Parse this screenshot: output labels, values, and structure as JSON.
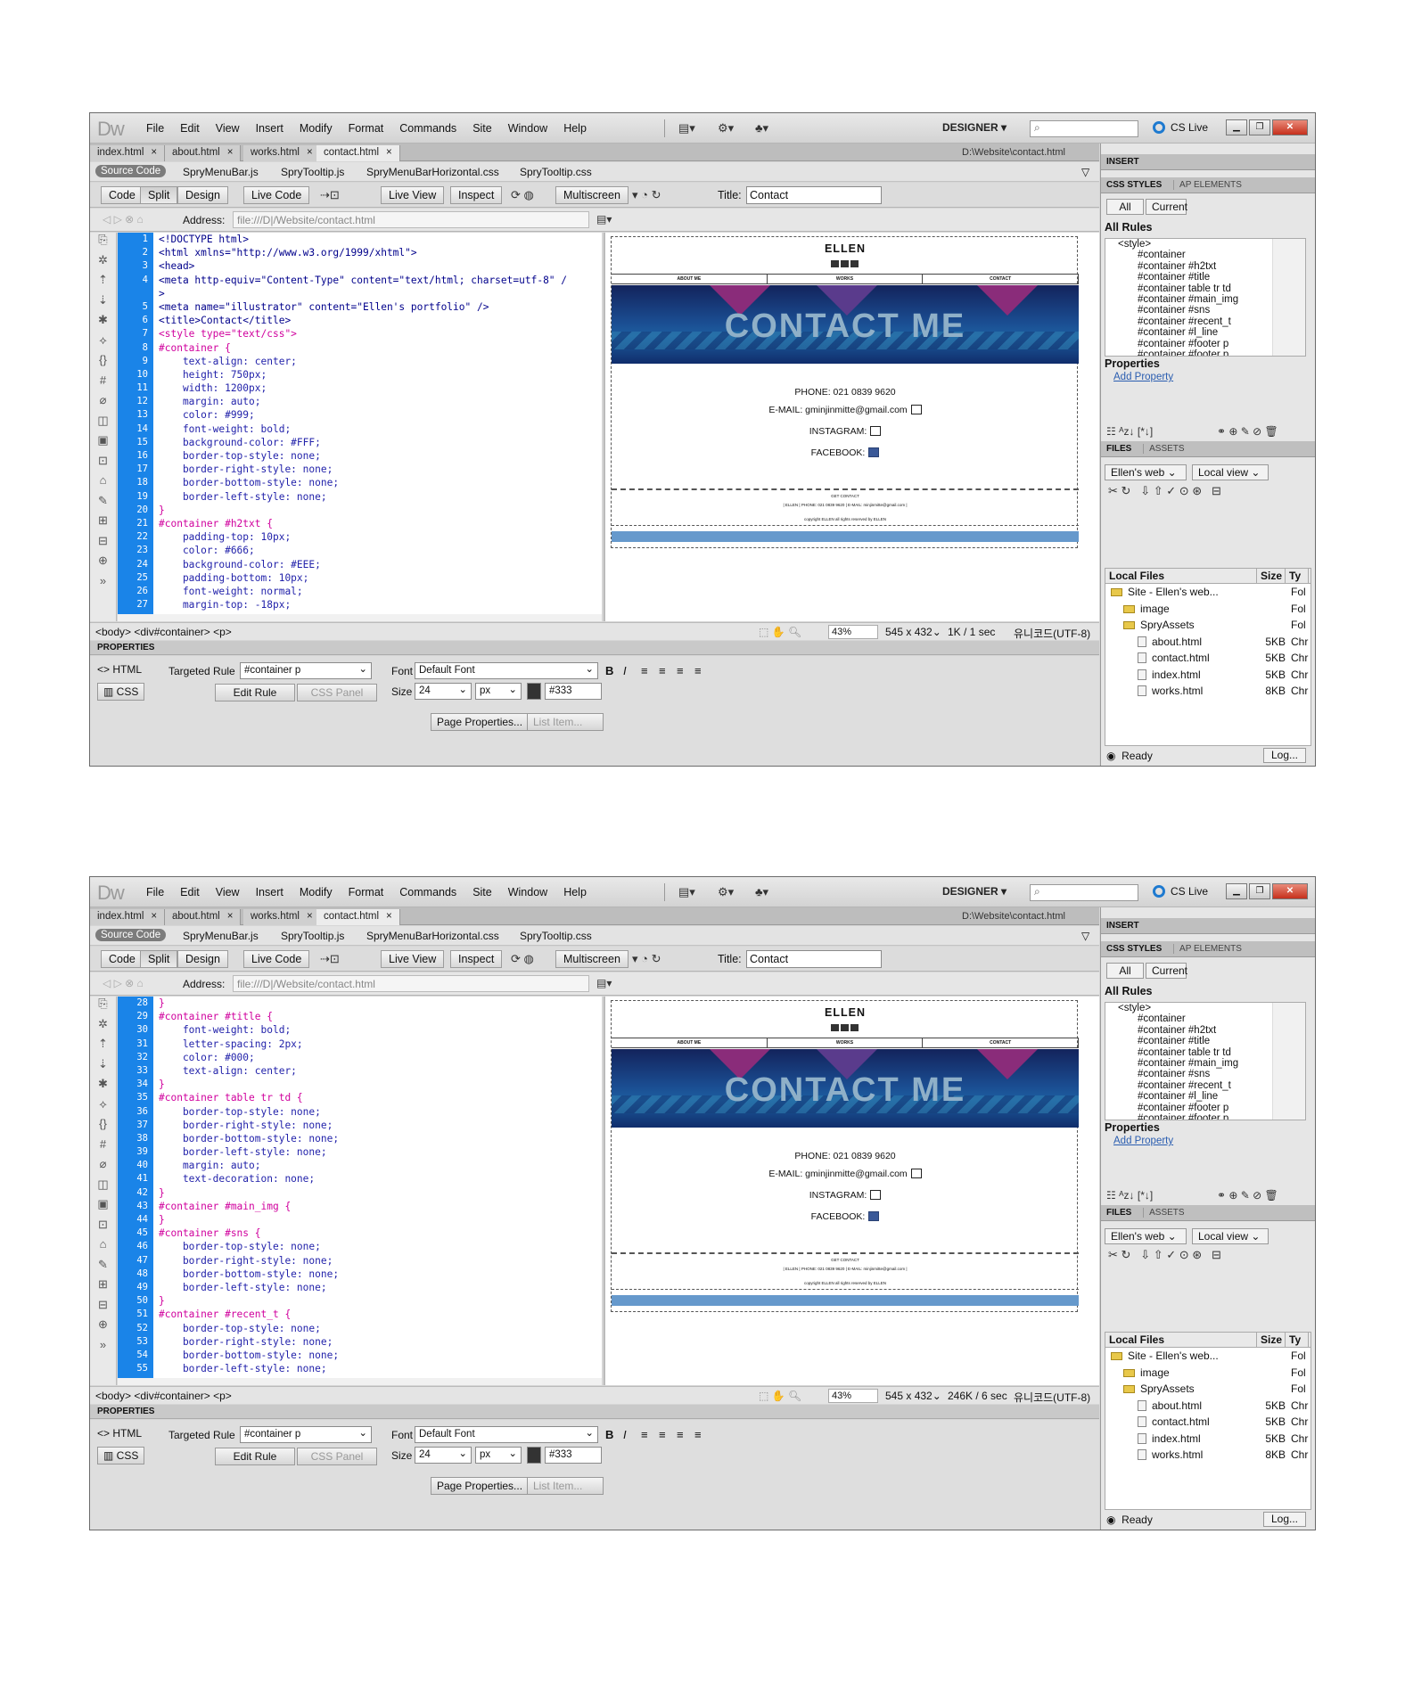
{
  "app": {
    "logo": "Dw",
    "menu": [
      "File",
      "Edit",
      "View",
      "Insert",
      "Modify",
      "Format",
      "Commands",
      "Site",
      "Window",
      "Help"
    ],
    "workspace": "DESIGNER",
    "cslive": "CS Live"
  },
  "tabs": [
    "index.html",
    "about.html",
    "works.html",
    "contact.html"
  ],
  "active_tab": "contact.html",
  "doc_path": "D:\\Website\\contact.html",
  "related_files": [
    "SpryMenuBar.js",
    "SpryTooltip.js",
    "SpryMenuBarHorizontal.css",
    "SpryTooltip.css"
  ],
  "source_code": "Source Code",
  "views": {
    "code": "Code",
    "split": "Split",
    "design": "Design",
    "live_code": "Live Code",
    "live_view": "Live View",
    "inspect": "Inspect",
    "multiscreen": "Multiscreen"
  },
  "title_label": "Title:",
  "title_value": "Contact",
  "address_label": "Address:",
  "address_value": "file:///D|/Website/contact.html",
  "preview": {
    "ellen": "ELLEN",
    "nav": [
      "ABOUT ME",
      "WORKS",
      "CONTACT"
    ],
    "banner": "CONTACT ME",
    "phone": "PHONE: 021 0839 9620",
    "email": "E-MAIL: gminjinmitte@gmail.com",
    "instagram": "INSTAGRAM:",
    "facebook": "FACEBOOK:",
    "footer1": "GET CONTACT",
    "footer2": "| ELLEN | PHONE: 021 0839 9620 | E-MAIL: minjinmitte@gmail.com |",
    "footer3": "copyright ELLEN all rights reserved by ELLEN"
  },
  "status": {
    "tags": "<body> <div#container> <p>",
    "zoom": "43%",
    "size": "545 x 432",
    "encoding": "유니코드(UTF-8)"
  },
  "properties": {
    "header": "PROPERTIES",
    "html": "HTML",
    "css": "CSS",
    "targeted_rule_label": "Targeted Rule",
    "targeted_rule": "#container p",
    "edit_rule": "Edit Rule",
    "css_panel": "CSS Panel",
    "font_label": "Font",
    "font": "Default Font",
    "size_label": "Size",
    "size": "24",
    "unit": "px",
    "color": "#333",
    "page_properties": "Page Properties...",
    "list_item": "List Item..."
  },
  "panels": {
    "insert": "INSERT",
    "css_styles": "CSS STYLES",
    "ap_elements": "AP ELEMENTS",
    "all": "All",
    "current": "Current",
    "all_rules": "All Rules",
    "rules": [
      "<style>",
      "#container",
      "#container #h2txt",
      "#container #title",
      "#container table tr td",
      "#container #main_img",
      "#container #sns",
      "#container #recent_t",
      "#container #l_line",
      "#container #footer p",
      "#container #footer p"
    ],
    "properties": "Properties",
    "add_property": "Add Property",
    "files": "FILES",
    "assets": "ASSETS",
    "site_select": "Ellen's web",
    "view_select": "Local view",
    "col_local": "Local Files",
    "col_size": "Size",
    "col_type": "Ty",
    "file_rows": [
      {
        "name": "Site - Ellen's web...",
        "size": "",
        "type": "Fol",
        "kind": "folder"
      },
      {
        "name": "image",
        "size": "",
        "type": "Fol",
        "kind": "folder"
      },
      {
        "name": "SpryAssets",
        "size": "",
        "type": "Fol",
        "kind": "folder"
      },
      {
        "name": "about.html",
        "size": "5KB",
        "type": "Chr",
        "kind": "file"
      },
      {
        "name": "contact.html",
        "size": "5KB",
        "type": "Chr",
        "kind": "file"
      },
      {
        "name": "index.html",
        "size": "5KB",
        "type": "Chr",
        "kind": "file"
      },
      {
        "name": "works.html",
        "size": "8KB",
        "type": "Chr",
        "kind": "file"
      }
    ],
    "ready": "Ready",
    "log": "Log..."
  },
  "windows": [
    {
      "download": "1K / 1 sec",
      "code_lines": [
        {
          "n": "1",
          "t": "<!DOCTYPE html>",
          "c": "tag"
        },
        {
          "n": "2",
          "t": "<html xmlns=\"http://www.w3.org/1999/xhtml\">",
          "c": "tag"
        },
        {
          "n": "3",
          "t": "<head>",
          "c": "tag"
        },
        {
          "n": "4",
          "t": "<meta http-equiv=\"Content-Type\" content=\"text/html; charset=utf-8\" /",
          "c": "tag"
        },
        {
          "n": "",
          "t": ">",
          "c": "tag"
        },
        {
          "n": "5",
          "t": "<meta name=\"illustrator\" content=\"Ellen's portfolio\" />",
          "c": "tag"
        },
        {
          "n": "6",
          "t": "<title>Contact</title>",
          "c": "tag"
        },
        {
          "n": "7",
          "t": "<style type=\"text/css\">",
          "c": "sel"
        },
        {
          "n": "8",
          "t": "#container {",
          "c": "sel"
        },
        {
          "n": "9",
          "t": "    text-align: center;",
          "c": "prop"
        },
        {
          "n": "10",
          "t": "    height: 750px;",
          "c": "prop"
        },
        {
          "n": "11",
          "t": "    width: 1200px;",
          "c": "prop"
        },
        {
          "n": "12",
          "t": "    margin: auto;",
          "c": "prop"
        },
        {
          "n": "13",
          "t": "    color: #999;",
          "c": "prop"
        },
        {
          "n": "14",
          "t": "    font-weight: bold;",
          "c": "prop"
        },
        {
          "n": "15",
          "t": "    background-color: #FFF;",
          "c": "prop"
        },
        {
          "n": "16",
          "t": "    border-top-style: none;",
          "c": "prop"
        },
        {
          "n": "17",
          "t": "    border-right-style: none;",
          "c": "prop"
        },
        {
          "n": "18",
          "t": "    border-bottom-style: none;",
          "c": "prop"
        },
        {
          "n": "19",
          "t": "    border-left-style: none;",
          "c": "prop"
        },
        {
          "n": "20",
          "t": "}",
          "c": "sel"
        },
        {
          "n": "21",
          "t": "#container #h2txt {",
          "c": "sel"
        },
        {
          "n": "22",
          "t": "    padding-top: 10px;",
          "c": "prop"
        },
        {
          "n": "23",
          "t": "    color: #666;",
          "c": "prop"
        },
        {
          "n": "24",
          "t": "    background-color: #EEE;",
          "c": "prop"
        },
        {
          "n": "25",
          "t": "    padding-bottom: 10px;",
          "c": "prop"
        },
        {
          "n": "26",
          "t": "    font-weight: normal;",
          "c": "prop"
        },
        {
          "n": "27",
          "t": "    margin-top: -18px;",
          "c": "prop"
        }
      ]
    },
    {
      "download": "246K / 6 sec",
      "code_lines": [
        {
          "n": "28",
          "t": "}",
          "c": "sel"
        },
        {
          "n": "29",
          "t": "#container #title {",
          "c": "sel"
        },
        {
          "n": "30",
          "t": "    font-weight: bold;",
          "c": "prop"
        },
        {
          "n": "31",
          "t": "    letter-spacing: 2px;",
          "c": "prop"
        },
        {
          "n": "32",
          "t": "    color: #000;",
          "c": "prop"
        },
        {
          "n": "33",
          "t": "    text-align: center;",
          "c": "prop"
        },
        {
          "n": "34",
          "t": "}",
          "c": "sel"
        },
        {
          "n": "35",
          "t": "#container table tr td {",
          "c": "sel"
        },
        {
          "n": "36",
          "t": "    border-top-style: none;",
          "c": "prop"
        },
        {
          "n": "37",
          "t": "    border-right-style: none;",
          "c": "prop"
        },
        {
          "n": "38",
          "t": "    border-bottom-style: none;",
          "c": "prop"
        },
        {
          "n": "39",
          "t": "    border-left-style: none;",
          "c": "prop"
        },
        {
          "n": "40",
          "t": "    margin: auto;",
          "c": "prop"
        },
        {
          "n": "41",
          "t": "    text-decoration: none;",
          "c": "prop"
        },
        {
          "n": "42",
          "t": "}",
          "c": "sel"
        },
        {
          "n": "43",
          "t": "#container #main_img {",
          "c": "sel"
        },
        {
          "n": "44",
          "t": "}",
          "c": "sel"
        },
        {
          "n": "45",
          "t": "#container #sns {",
          "c": "sel"
        },
        {
          "n": "46",
          "t": "    border-top-style: none;",
          "c": "prop"
        },
        {
          "n": "47",
          "t": "    border-right-style: none;",
          "c": "prop"
        },
        {
          "n": "48",
          "t": "    border-bottom-style: none;",
          "c": "prop"
        },
        {
          "n": "49",
          "t": "    border-left-style: none;",
          "c": "prop"
        },
        {
          "n": "50",
          "t": "}",
          "c": "sel"
        },
        {
          "n": "51",
          "t": "#container #recent_t {",
          "c": "sel"
        },
        {
          "n": "52",
          "t": "    border-top-style: none;",
          "c": "prop"
        },
        {
          "n": "53",
          "t": "    border-right-style: none;",
          "c": "prop"
        },
        {
          "n": "54",
          "t": "    border-bottom-style: none;",
          "c": "prop"
        },
        {
          "n": "55",
          "t": "    border-left-style: none;",
          "c": "prop"
        }
      ]
    }
  ]
}
